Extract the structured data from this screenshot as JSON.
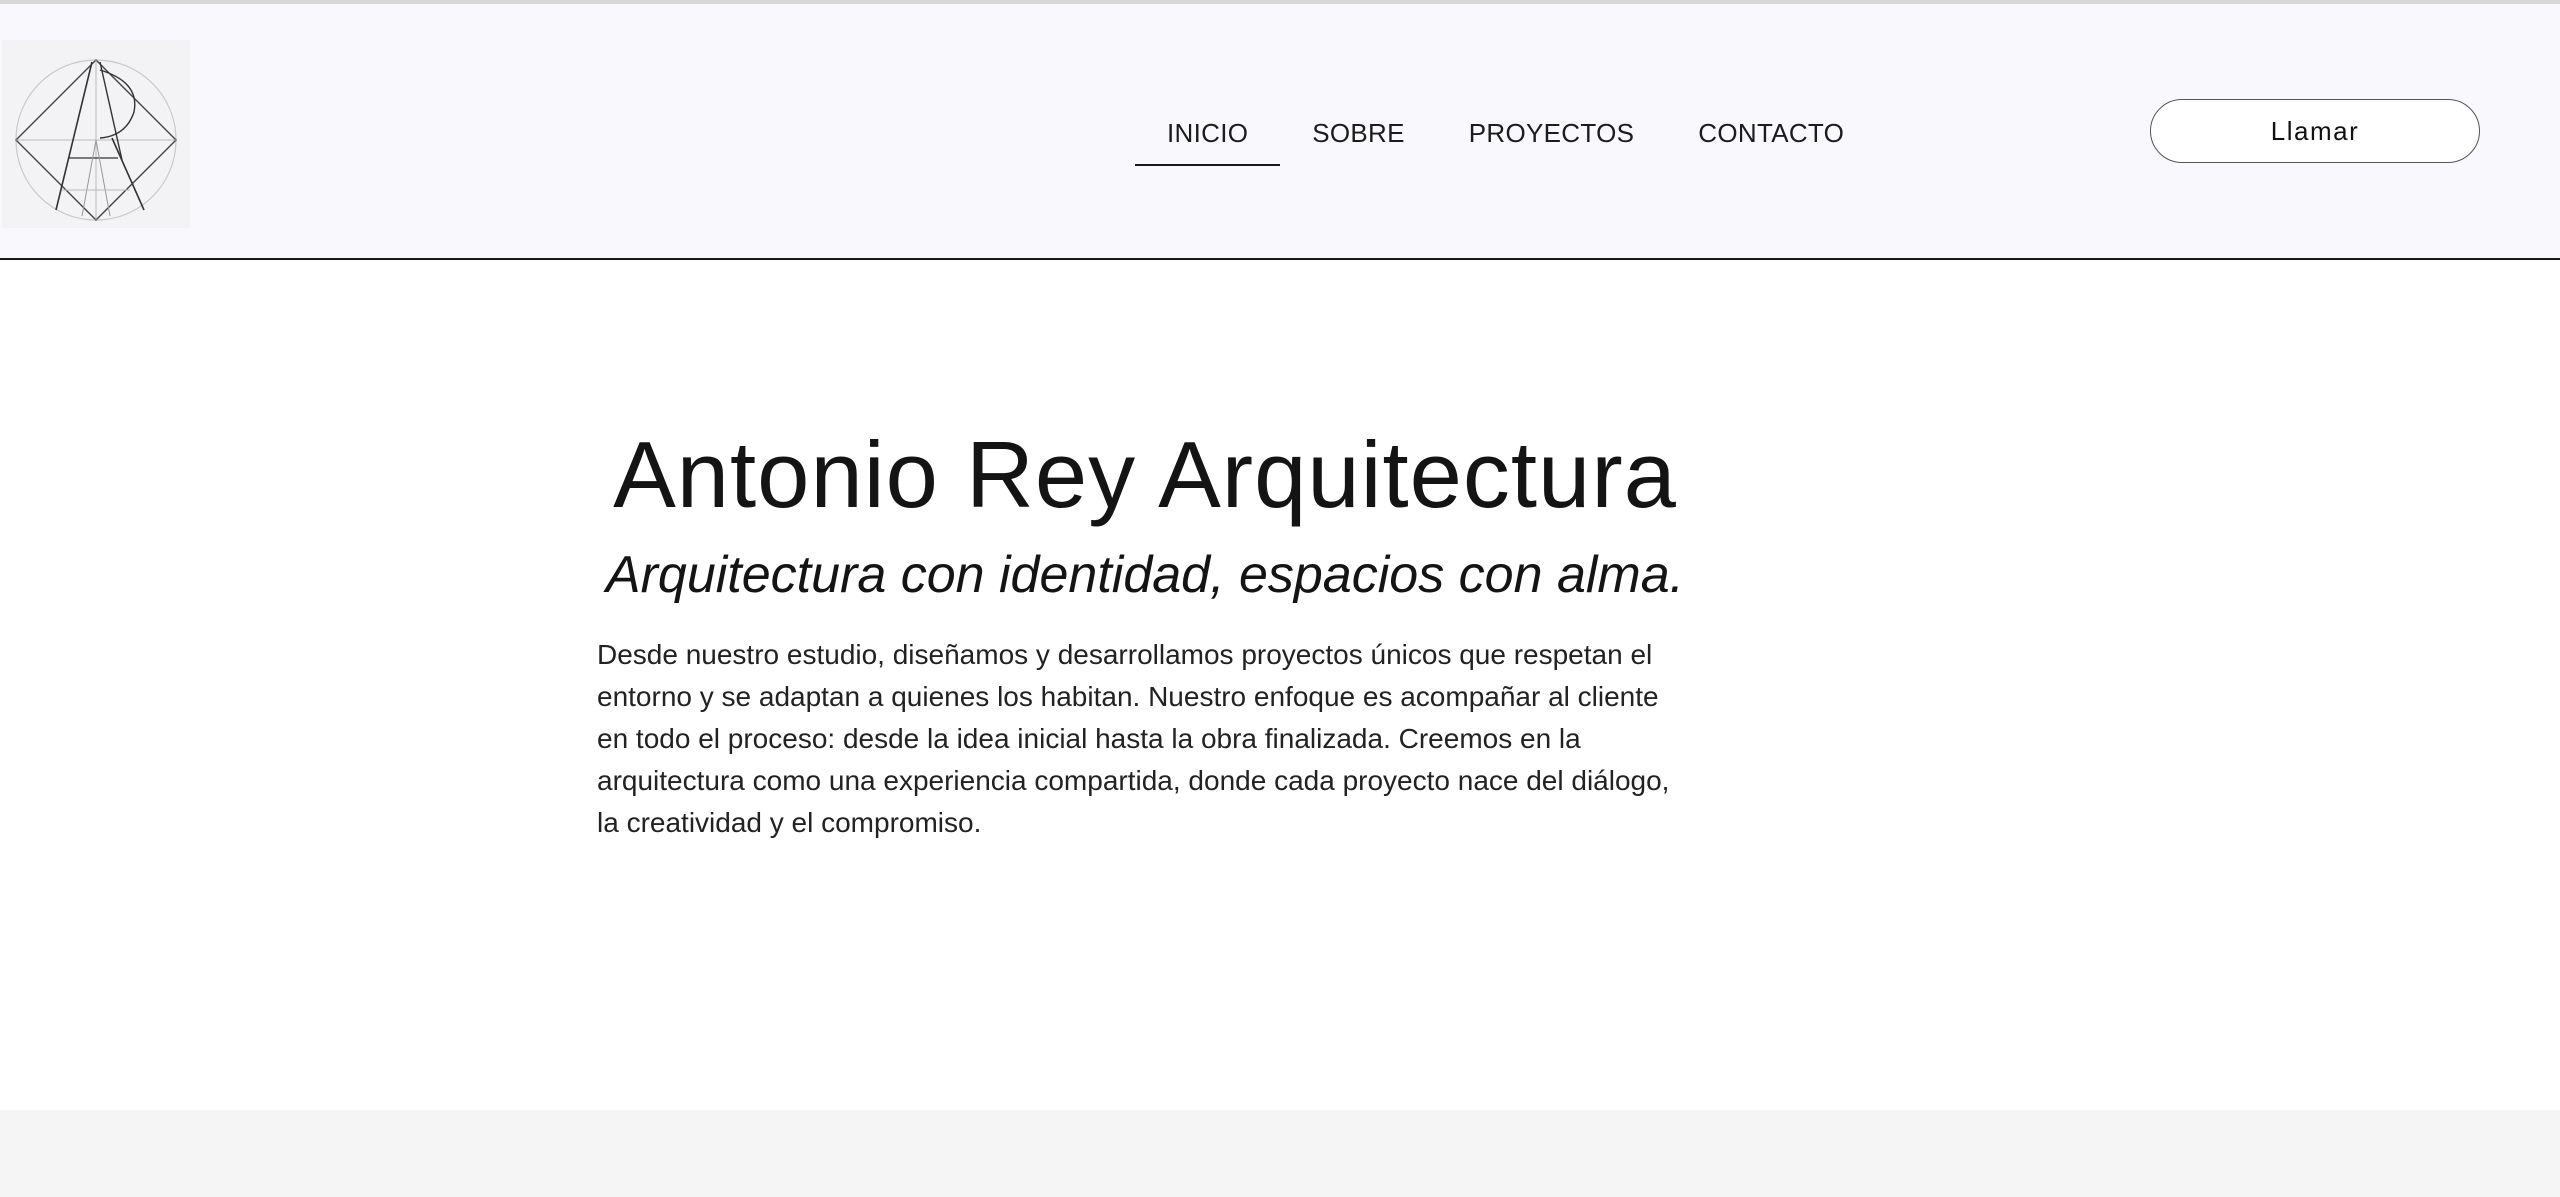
{
  "header": {
    "logo_alt": "AR",
    "nav": [
      {
        "label": "INICIO",
        "active": true
      },
      {
        "label": "SOBRE",
        "active": false
      },
      {
        "label": "PROYECTOS",
        "active": false
      },
      {
        "label": "CONTACTO",
        "active": false
      }
    ],
    "call_label": "Llamar"
  },
  "hero": {
    "title": "Antonio Rey Arquitectura",
    "tagline": "Arquitectura con identidad, espacios con alma.",
    "body": "Desde nuestro estudio, diseñamos y desarrollamos proyectos únicos que respetan el entorno y se adaptan a quienes los habitan. Nuestro enfoque es acompañar al cliente en todo el proceso: desde la idea inicial hasta la obra finalizada. Creemos en la arquitectura como una experiencia compartida, donde cada proyecto nace del diálogo, la creatividad y el compromiso."
  },
  "colors": {
    "header_bg": "#f9f9fd",
    "text": "#141414",
    "footer_band": "#f5f5f5"
  }
}
